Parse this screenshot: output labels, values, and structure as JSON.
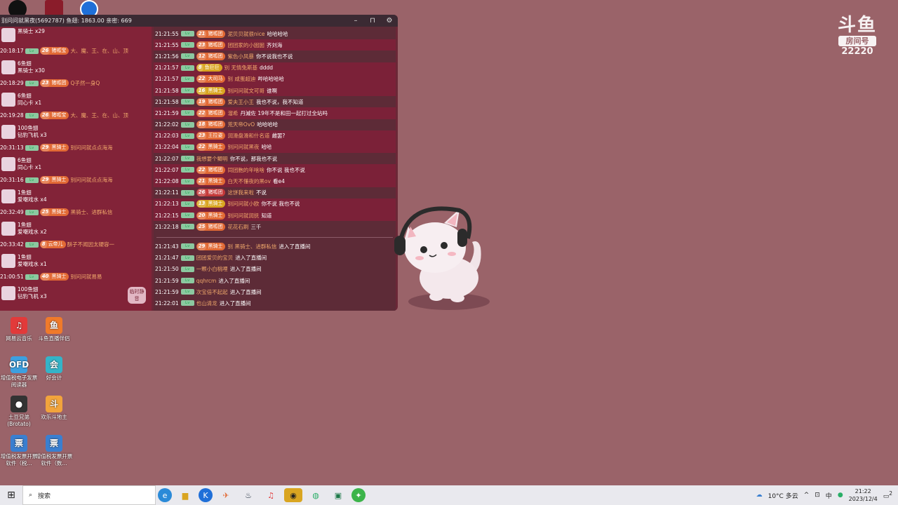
{
  "window": {
    "title": "别问问就黑夜(5692787) 鱼翅: 1863.00 亲密: 669",
    "mute_label": "临时静音"
  },
  "gifts": [
    {
      "type": "gift",
      "line1": "黑骑士 x29",
      "line2": ""
    },
    {
      "type": "enter",
      "time": "20:18:17",
      "fan_level": "26",
      "fan_name": "猪呱宝",
      "user": "大、魔、王、在、山、顶"
    },
    {
      "type": "gift",
      "line1": "6鱼翅",
      "line2": "黑骑士 x30"
    },
    {
      "type": "enter",
      "time": "20:18:29",
      "fan_level": "23",
      "fan_name": "猪呱团",
      "user": "Q子然一身Q"
    },
    {
      "type": "gift",
      "line1": "6鱼翅",
      "line2": "同心卡 x1"
    },
    {
      "type": "enter",
      "time": "20:19:28",
      "fan_level": "26",
      "fan_name": "猪呱宝",
      "user": "大、魔、王、在、山、顶"
    },
    {
      "type": "gift",
      "line1": "100鱼翅",
      "line2": "钻豹飞机 x3"
    },
    {
      "type": "enter",
      "time": "20:31:13",
      "fan_level": "29",
      "fan_name": "黑骑士",
      "user": "别问问就点点海海"
    },
    {
      "type": "gift",
      "line1": "6鱼翅",
      "line2": "同心卡 x1"
    },
    {
      "type": "enter",
      "time": "20:31:16",
      "fan_level": "29",
      "fan_name": "黑骑士",
      "user": "别问问就点点海海"
    },
    {
      "type": "gift",
      "line1": "1鱼翅",
      "line2": "爱嘲戏水 x4"
    },
    {
      "type": "enter",
      "time": "20:32:49",
      "fan_level": "25",
      "fan_name": "黑骑士",
      "user": "黑骑士、进群私信"
    },
    {
      "type": "gift",
      "line1": "1鱼翅",
      "line2": "爱嘲戏水 x2"
    },
    {
      "type": "enter",
      "time": "20:33:42",
      "fan_level": "8",
      "fan_name": "云帝儿",
      "user": "酥子不闻因太硬容一"
    },
    {
      "type": "gift",
      "line1": "1鱼翅",
      "line2": "爱嘲戏水 x1"
    },
    {
      "type": "enter",
      "time": "21:00:51",
      "fan_level": "40",
      "fan_name": "黑骑士",
      "user": "别问问就易易"
    },
    {
      "type": "gift",
      "line1": "100鱼翅",
      "line2": "钻豹飞机 x3"
    }
  ],
  "chat": [
    {
      "time": "21:21:55",
      "lv": "21",
      "fan": "猪呱团",
      "user": "泥贝贝就很nice",
      "msg": "哈哈哈哈",
      "hl": false,
      "color": "orange"
    },
    {
      "time": "21:21:55",
      "lv": "23",
      "fan": "猪呱团",
      "user": "团团家的小囡囡",
      "msg": "齐刘海",
      "hl": true,
      "color": "orange"
    },
    {
      "time": "21:21:56",
      "lv": "12",
      "fan": "猪呱团",
      "user": "紫色小风暴",
      "msg": "你不说我也不说",
      "hl": false,
      "color": "orange"
    },
    {
      "time": "21:21:57",
      "lv": "8",
      "fan": "鱼巨巨",
      "user": "别 无情兔斯基",
      "msg": "dddd",
      "hl": true,
      "color": "yellow"
    },
    {
      "time": "21:21:57",
      "lv": "22",
      "fan": "大司马",
      "user": "别 咸蛋超迪",
      "msg": "哔哈哈哈哈",
      "hl": true,
      "color": "orange"
    },
    {
      "time": "21:21:58",
      "lv": "16",
      "fan": "黑骑士",
      "user": "别问问就文可哥",
      "msg": "谁啊",
      "hl": true,
      "color": "yellow"
    },
    {
      "time": "21:21:58",
      "lv": "19",
      "fan": "猪呱团",
      "user": "爱夫王小王",
      "msg": "我也不说，我不知道",
      "hl": false,
      "color": "orange"
    },
    {
      "time": "21:21:59",
      "lv": "22",
      "fan": "猪呱团",
      "user": "溜希",
      "msg": "丹滅佐 19年不是和田一起打过全站吗",
      "hl": true,
      "color": "orange"
    },
    {
      "time": "21:22:02",
      "lv": "18",
      "fan": "猪呱团",
      "user": "荒天帝OvO",
      "msg": "哈哈哈哈",
      "hl": false,
      "color": "orange"
    },
    {
      "time": "21:22:03",
      "lv": "23",
      "fan": "王拉姿",
      "user": "润滑盘滑和什名道",
      "msg": "雌罢?",
      "hl": true,
      "color": "orange"
    },
    {
      "time": "21:22:04",
      "lv": "22",
      "fan": "黑骑士",
      "user": "别问问就黑夜",
      "msg": "哈哈",
      "hl": true,
      "color": "orange"
    },
    {
      "time": "21:22:07",
      "lv": "",
      "fan": "",
      "user": "我想要个鲫明",
      "msg": "你不说，那我也不说",
      "hl": false,
      "color": ""
    },
    {
      "time": "21:22:07",
      "lv": "22",
      "fan": "猪呱团",
      "user": "同团胞的年啥啥",
      "msg": "你不说 我也不说",
      "hl": true,
      "color": "orange"
    },
    {
      "time": "21:22:08",
      "lv": "21",
      "fan": "黑骑士",
      "user": "白天不懂夜的黑ov",
      "msg": "看e4",
      "hl": true,
      "color": "orange"
    },
    {
      "time": "21:22:11",
      "lv": "26",
      "fan": "猪呱团",
      "user": "这饼我来啦",
      "msg": "不说",
      "hl": false,
      "color": "red"
    },
    {
      "time": "21:22:13",
      "lv": "13",
      "fan": "黑骑士",
      "user": "别问问就小欧",
      "msg": "你不说 我也不说",
      "hl": true,
      "color": "yellow"
    },
    {
      "time": "21:22:15",
      "lv": "20",
      "fan": "黑骑士",
      "user": "别问问就润抚",
      "msg": "知道",
      "hl": true,
      "color": "orange"
    },
    {
      "time": "21:22:18",
      "lv": "25",
      "fan": "猪呱团",
      "user": "花花石刷",
      "msg": "三千",
      "hl": false,
      "color": "orange"
    }
  ],
  "entries": [
    {
      "time": "21:21:43",
      "lv": "29",
      "fan": "黑骑士",
      "user": "别 黑骑士、进群私信",
      "msg": "进入了直播间"
    },
    {
      "time": "21:21:47",
      "lv": "",
      "fan": "",
      "user": "团团爱贝的宝贝",
      "msg": "进入了直播间"
    },
    {
      "time": "21:21:50",
      "lv": "",
      "fan": "",
      "user": "一颗小白桃哩",
      "msg": "进入了直播间"
    },
    {
      "time": "21:21:59",
      "lv": "",
      "fan": "",
      "user": "qqhrcm",
      "msg": "进入了直播间"
    },
    {
      "time": "21:21:59",
      "lv": "",
      "fan": "",
      "user": "次宝倍不起起",
      "msg": "进入了直播间"
    },
    {
      "time": "21:22:01",
      "lv": "",
      "fan": "",
      "user": "也山清龙",
      "msg": "进入了直播间"
    }
  ],
  "brand": {
    "logo": "斗鱼",
    "badge": "房间号",
    "room": "22220"
  },
  "desktop_icons": [
    {
      "label": "网易云音乐",
      "color": "#e23a3a",
      "glyph": "♫"
    },
    {
      "label": "斗鱼直播伴侣",
      "color": "#f07a2a",
      "glyph": "鱼"
    },
    {
      "label": "增值税电子发票阅读器",
      "color": "#3ca0e0",
      "glyph": "OFD"
    },
    {
      "label": "好会计",
      "color": "#34b4c8",
      "glyph": "会"
    },
    {
      "label": "土豆兄弟(Brotato)",
      "color": "#333",
      "glyph": "●"
    },
    {
      "label": "欢乐斗地主",
      "color": "#f2a43c",
      "glyph": "斗"
    },
    {
      "label": "增值税发票开票软件（税...",
      "color": "#3a7fd0",
      "glyph": "票"
    },
    {
      "label": "增值税发票开票软件（数...",
      "color": "#3a7fd0",
      "glyph": "票"
    }
  ],
  "taskbar": {
    "search_placeholder": "搜索",
    "weather": "10°C 多云",
    "ime": "中",
    "time": "21:22",
    "date": "2023/12/4",
    "notif": "2"
  }
}
